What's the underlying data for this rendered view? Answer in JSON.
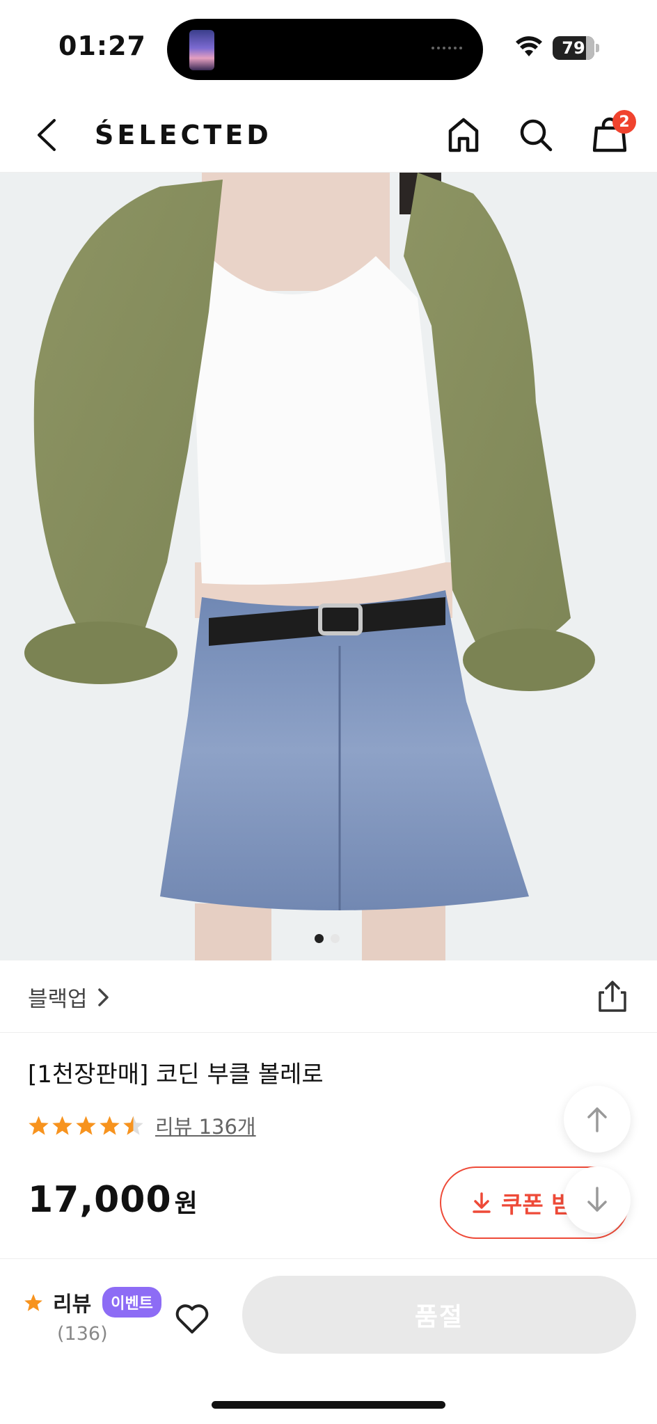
{
  "status_bar": {
    "time": "01:27",
    "battery": "79"
  },
  "header": {
    "brand": "ŚELECTED",
    "cart_count": "2"
  },
  "carousel": {
    "total": 2,
    "active": 0
  },
  "product": {
    "brand_name": "블랙업",
    "name": "[1천장판매] 코딘 부클 볼레로",
    "rating": 4.5,
    "review_link": "리뷰 136개",
    "price": "17,000",
    "price_unit": "원",
    "coupon_label": "쿠폰 받"
  },
  "bottom_bar": {
    "review_label": "리뷰",
    "event_badge": "이벤트",
    "review_count": "(136)",
    "buy_button": "품절"
  },
  "colors": {
    "accent": "#ee4a38",
    "star": "#f7931e",
    "event": "#8d6cf5",
    "sold_out_bg": "#e9e9e9"
  },
  "icons": [
    "back-arrow-icon",
    "home-icon",
    "search-icon",
    "shopping-bag-icon",
    "chevron-right-icon",
    "share-icon",
    "star-icon",
    "download-arrow-icon",
    "arrow-up-icon",
    "arrow-down-icon",
    "heart-icon",
    "wifi-icon"
  ]
}
